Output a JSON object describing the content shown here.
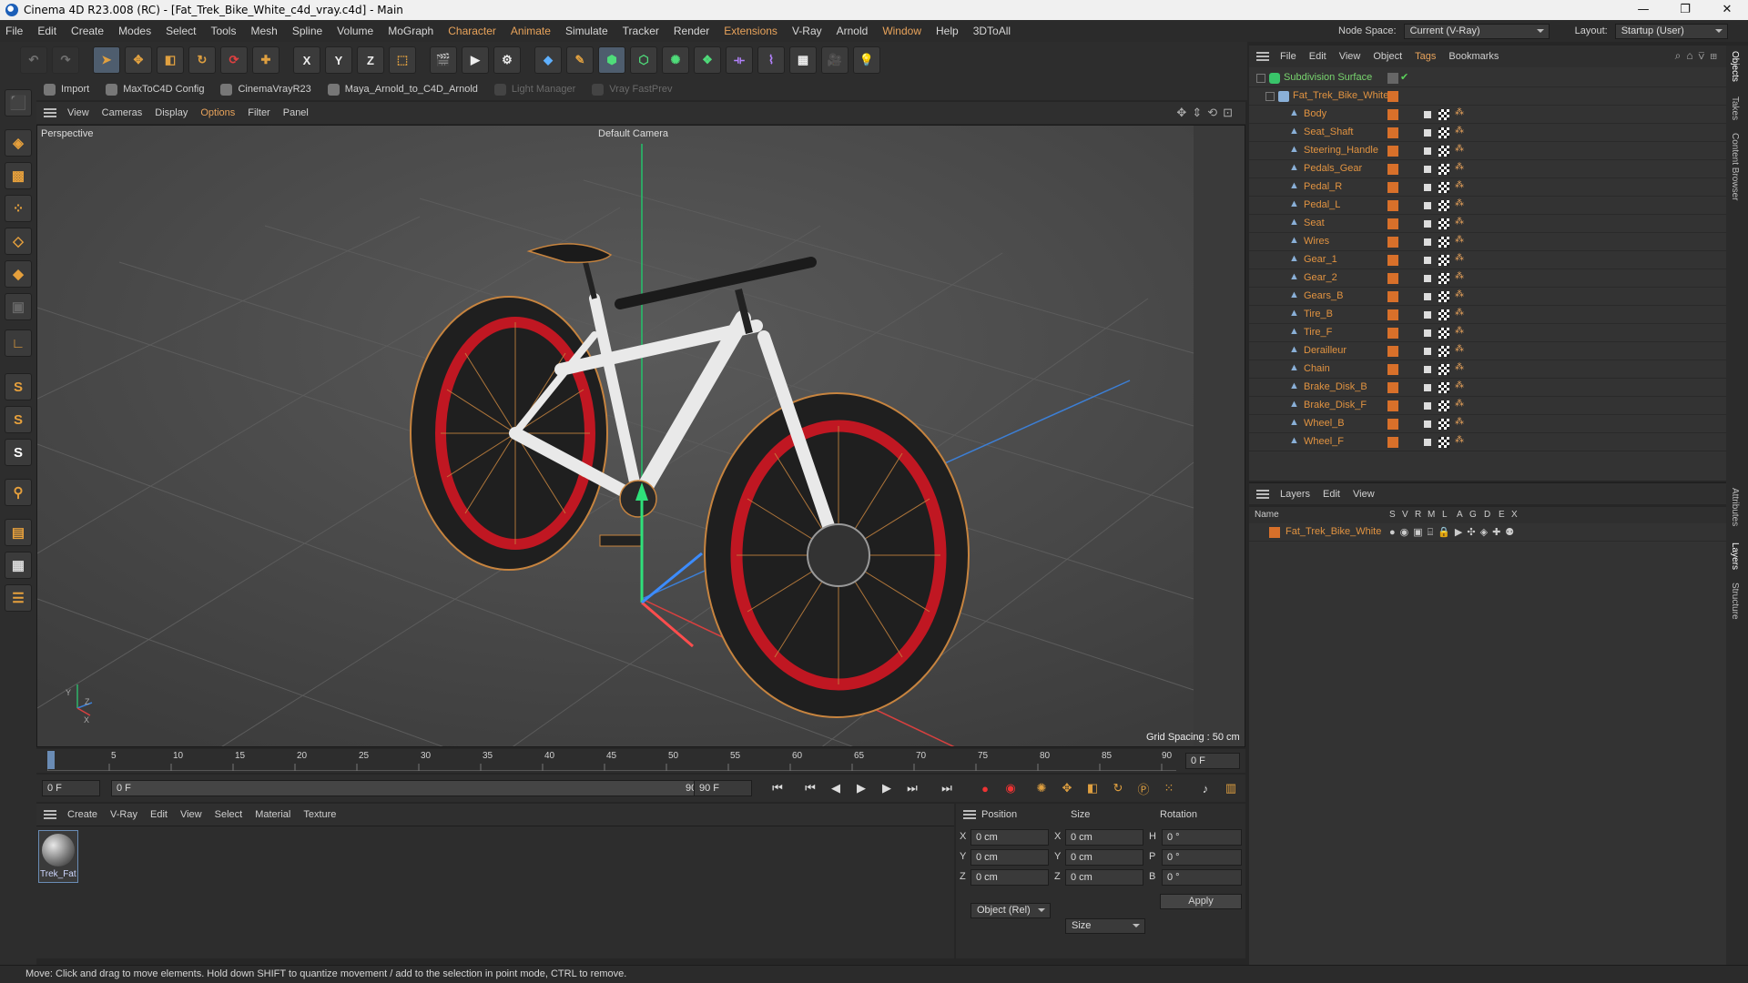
{
  "window": {
    "title": "Cinema 4D R23.008 (RC) - [Fat_Trek_Bike_White_c4d_vray.c4d] - Main",
    "controls": [
      "—",
      "❐",
      "✕"
    ]
  },
  "menubar": {
    "items": [
      "File",
      "Edit",
      "Create",
      "Modes",
      "Select",
      "Tools",
      "Mesh",
      "Spline",
      "Volume",
      "MoGraph",
      "Character",
      "Animate",
      "Simulate",
      "Tracker",
      "Render",
      "Extensions",
      "V-Ray",
      "Arnold",
      "Window",
      "Help",
      "3DToAll"
    ],
    "node_space_label": "Node Space:",
    "node_space_value": "Current (V-Ray)",
    "layout_label": "Layout:",
    "layout_value": "Startup (User)"
  },
  "toolbar": {
    "axis_x": "X",
    "axis_y": "Y",
    "axis_z": "Z"
  },
  "plugins": {
    "items": [
      "Import",
      "MaxToC4D Config",
      "CinemaVrayR23",
      "Maya_Arnold_to_C4D_Arnold",
      "Light Manager",
      "Vray FastPrev"
    ]
  },
  "left_toolbar": {
    "s1": "S",
    "s2": "S",
    "s3": "S"
  },
  "viewport": {
    "menu": [
      "View",
      "Cameras",
      "Display",
      "Options",
      "Filter",
      "Panel"
    ],
    "label": "Perspective",
    "camera": "Default Camera",
    "grid_spacing": "Grid Spacing : 50 cm",
    "axis_y": "Y",
    "axis_z": "Z",
    "axis_x": "X"
  },
  "timeline": {
    "ticks": [
      "0",
      "5",
      "10",
      "15",
      "20",
      "25",
      "30",
      "35",
      "40",
      "45",
      "50",
      "55",
      "60",
      "65",
      "70",
      "75",
      "80",
      "85",
      "90"
    ],
    "current_frame": "0 F"
  },
  "playbar": {
    "start": "0 F",
    "range_start": "0 F",
    "range_end": "90 F",
    "end": "90 F"
  },
  "material_manager": {
    "menu": [
      "Create",
      "V-Ray",
      "Edit",
      "View",
      "Select",
      "Material",
      "Texture"
    ],
    "material_name": "Trek_Fat"
  },
  "coordinates": {
    "headers": [
      "Position",
      "Size",
      "Rotation"
    ],
    "rows": [
      {
        "axis": "X",
        "pos": "0 cm",
        "size_axis": "X",
        "size": "0 cm",
        "rot_axis": "H",
        "rot": "0 °"
      },
      {
        "axis": "Y",
        "pos": "0 cm",
        "size_axis": "Y",
        "size": "0 cm",
        "rot_axis": "P",
        "rot": "0 °"
      },
      {
        "axis": "Z",
        "pos": "0 cm",
        "size_axis": "Z",
        "size": "0 cm",
        "rot_axis": "B",
        "rot": "0 °"
      }
    ],
    "mode": "Object (Rel)",
    "size_mode": "Size",
    "apply": "Apply"
  },
  "status": "Move: Click and drag to move elements. Hold down SHIFT to quantize movement / add to the selection in point mode, CTRL to remove.",
  "object_manager": {
    "menu": [
      "File",
      "Edit",
      "View",
      "Object",
      "Tags",
      "Bookmarks"
    ],
    "root": "Subdivision Surface",
    "group": "Fat_Trek_Bike_White",
    "children": [
      "Body",
      "Seat_Shaft",
      "Steering_Handle",
      "Pedals_Gear",
      "Pedal_R",
      "Pedal_L",
      "Seat",
      "Wires",
      "Gear_1",
      "Gear_2",
      "Gears_B",
      "Tire_B",
      "Tire_F",
      "Derailleur",
      "Chain",
      "Brake_Disk_B",
      "Brake_Disk_F",
      "Wheel_B",
      "Wheel_F"
    ]
  },
  "layer_manager": {
    "menu": [
      "Layers",
      "Edit",
      "View"
    ],
    "columns": [
      "Name",
      "S",
      "V",
      "R",
      "M",
      "L",
      "A",
      "G",
      "D",
      "E",
      "X"
    ],
    "layers": [
      "Fat_Trek_Bike_White"
    ]
  },
  "right_tabs": [
    "Objects",
    "Takes",
    "Content Browser",
    "Attributes",
    "Layers",
    "Structure"
  ],
  "colors": {
    "accent": "#e19341",
    "highlight": "#e8a35b",
    "bg": "#262626"
  }
}
